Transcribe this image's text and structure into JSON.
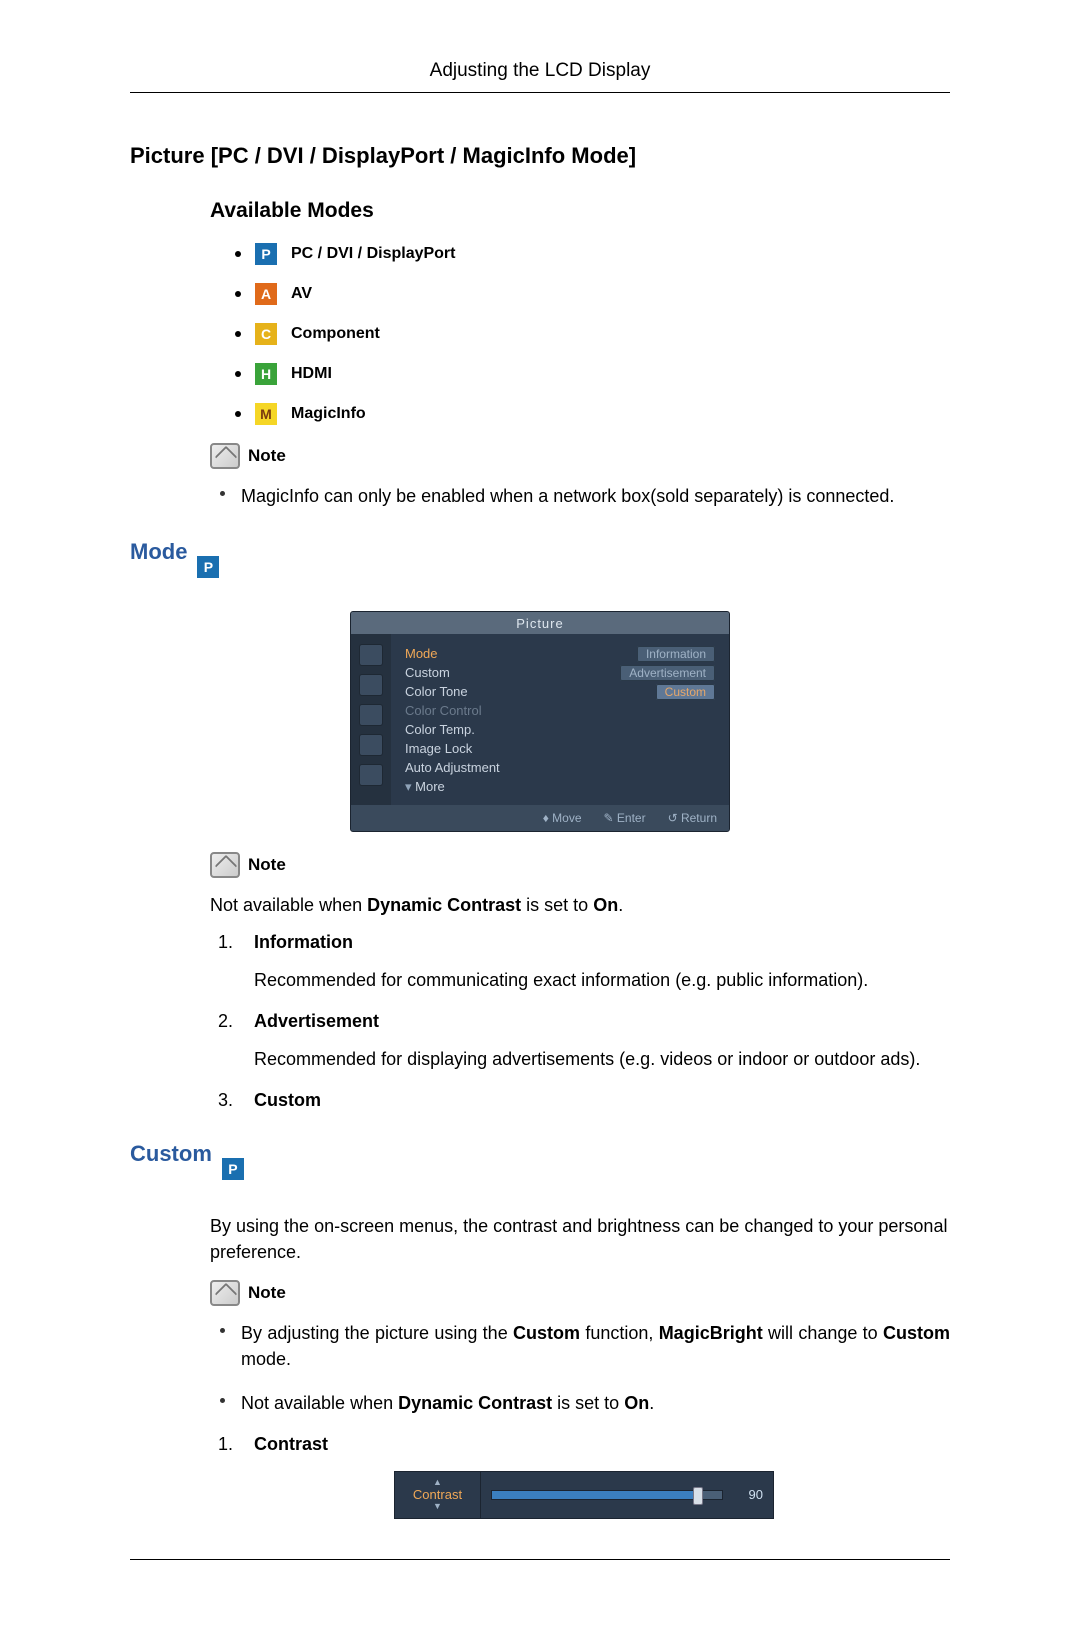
{
  "header": {
    "title": "Adjusting the LCD Display"
  },
  "h1": "Picture [PC / DVI / DisplayPort / MagicInfo Mode]",
  "available_modes": {
    "heading": "Available Modes",
    "items": [
      {
        "badge": "P",
        "cls": "badge-p",
        "label": "PC / DVI / DisplayPort"
      },
      {
        "badge": "A",
        "cls": "badge-a",
        "label": "AV"
      },
      {
        "badge": "C",
        "cls": "badge-c",
        "label": "Component"
      },
      {
        "badge": "H",
        "cls": "badge-h",
        "label": "HDMI"
      },
      {
        "badge": "M",
        "cls": "badge-m",
        "label": "MagicInfo"
      }
    ]
  },
  "note_label": "Note",
  "magicinfo_note": "MagicInfo can only be enabled when a network box(sold separately) is connected.",
  "mode": {
    "heading": "Mode",
    "osd": {
      "title": "Picture",
      "items": [
        {
          "label": "Mode",
          "right": "Information",
          "active": true,
          "right_sel": false
        },
        {
          "label": "Custom",
          "right": "Advertisement",
          "right_sel": false
        },
        {
          "label": "Color Tone",
          "right": "Custom",
          "right_sel": true
        },
        {
          "label": "Color Control",
          "dim": true
        },
        {
          "label": "Color Temp."
        },
        {
          "label": "Image Lock"
        },
        {
          "label": "Auto Adjustment"
        },
        {
          "label": "More",
          "more": true
        }
      ],
      "footer": {
        "move": "Move",
        "enter": "Enter",
        "return": "Return"
      }
    },
    "not_available_prefix": "Not available when ",
    "dynamic_contrast": "Dynamic Contrast",
    "is_set_to": " is set to ",
    "on": "On",
    "period": ".",
    "options": [
      {
        "num": "1.",
        "title": "Information",
        "desc": "Recommended for communicating exact information (e.g. public information)."
      },
      {
        "num": "2.",
        "title": "Advertisement",
        "desc": "Recommended for displaying advertisements (e.g. videos or indoor or outdoor ads)."
      },
      {
        "num": "3.",
        "title": "Custom",
        "desc": ""
      }
    ]
  },
  "custom": {
    "heading": "Custom",
    "intro": "By using the on-screen menus, the contrast and brightness can be changed to your personal preference.",
    "bullets": {
      "b1_pre": "By adjusting the picture using the ",
      "b1_custom": "Custom",
      "b1_mid": " function, ",
      "b1_mb": "MagicBright",
      "b1_mid2": " will change to ",
      "b1_custom2": "Custom",
      "b1_post": " mode.",
      "b2_pre": "Not available when ",
      "b2_dc": "Dynamic Contrast",
      "b2_mid": " is set to ",
      "b2_on": "On",
      "b2_post": "."
    },
    "contrast": {
      "num": "1.",
      "title": "Contrast",
      "slider": {
        "label": "Contrast",
        "value": "90",
        "percent": 90
      }
    }
  }
}
